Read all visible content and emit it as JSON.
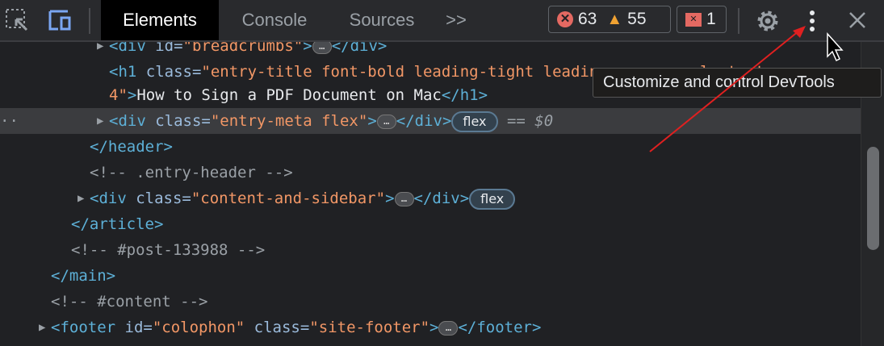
{
  "toolbar": {
    "tabs": [
      {
        "label": "Elements",
        "active": true
      },
      {
        "label": "Console"
      },
      {
        "label": "Sources"
      }
    ],
    "more_tabs": ">>",
    "errors": "63",
    "warnings": "55",
    "issues": "1"
  },
  "tooltip": "Customize and control DevTools",
  "code": {
    "l1": {
      "open": "<div ",
      "attr": "id=",
      "val": "\"breadcrumbs\"",
      "gt": ">",
      "close": "</div>"
    },
    "l2": {
      "open": "<h1 ",
      "attr": "class=",
      "val": "\"entry-title font-bold leading-tight leading-none ... lg:text-"
    },
    "l3": {
      "val": "4\"",
      "gt": ">",
      "text": "How to Sign a PDF Document on Mac",
      "close": "</h1>"
    },
    "l4": {
      "open": "<div ",
      "attr": "class=",
      "val": "\"entry-meta flex\"",
      "gt": ">",
      "close": "</div>",
      "pill": "flex",
      "eq": "== $0"
    },
    "l5": "</header>",
    "l6": "<!-- .entry-header -->",
    "l7": {
      "open": "<div ",
      "attr": "class=",
      "val": "\"content-and-sidebar\"",
      "gt": ">",
      "close": "</div>",
      "pill": "flex"
    },
    "l8": "</article>",
    "l9": "<!-- #post-133988 -->",
    "l10": "</main>",
    "l11": "<!-- #content -->",
    "l12": {
      "open": "<footer ",
      "attr1": "id=",
      "val1": "\"colophon\"",
      "attr2": " class=",
      "val2": "\"site-footer\"",
      "gt": ">",
      "close": "</footer>"
    }
  },
  "colors": {
    "accent_arrow": "#e02020",
    "error": "#e46962",
    "warning": "#f0a232"
  }
}
